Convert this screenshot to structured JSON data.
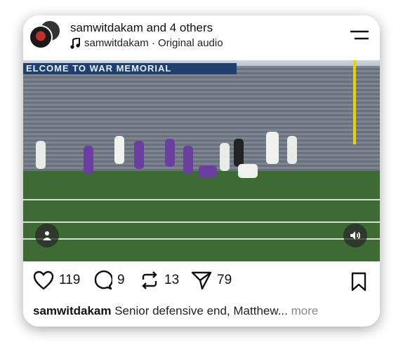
{
  "post": {
    "author": "samwitdakam",
    "coauthors_suffix": "and 4 others",
    "audio": "samwitdakam · Original audio",
    "stadium_banner": "ELCOME TO WAR MEMORIAL",
    "likes": "119",
    "comments": "9",
    "reposts": "13",
    "shares": "79",
    "caption_user": "samwitdakam",
    "caption_text": " Senior defensive end, Matthew...",
    "caption_more": " more"
  },
  "icons": [
    "menu-icon",
    "music-note-icon",
    "person-icon",
    "volume-icon",
    "heart-icon",
    "comment-icon",
    "repost-icon",
    "send-icon",
    "bookmark-icon"
  ]
}
